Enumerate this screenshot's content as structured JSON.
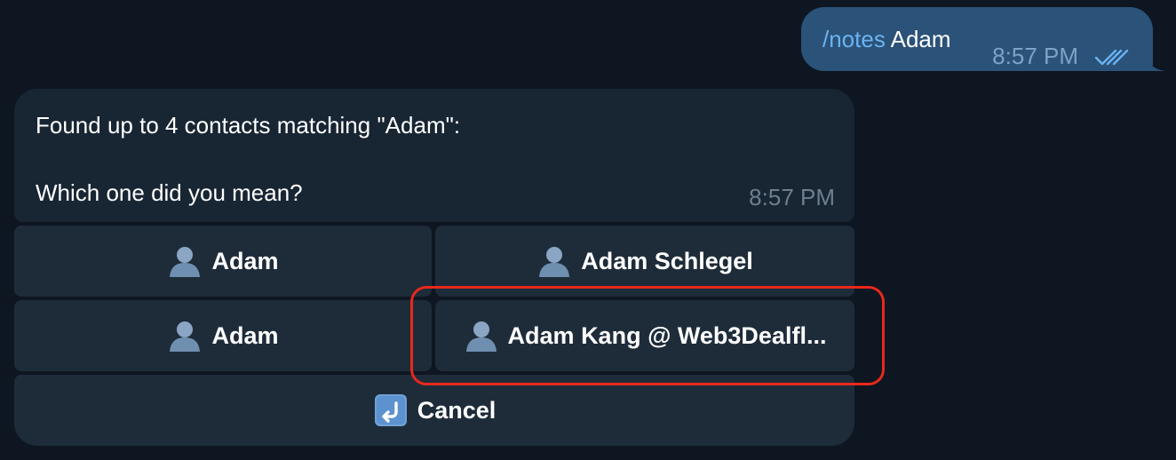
{
  "outgoing_message": {
    "command": "/notes",
    "text": " Adam",
    "time": "8:57 PM",
    "status_icon": "double-check-icon"
  },
  "incoming_message": {
    "line1": "Found up to 4 contacts matching \"Adam\":",
    "line2": "Which one did you mean?",
    "time": "8:57 PM"
  },
  "keyboard": {
    "buttons": [
      {
        "label": "Adam",
        "icon": "person-silhouette-icon"
      },
      {
        "label": "Adam Schlegel",
        "icon": "person-silhouette-icon"
      },
      {
        "label": "Adam",
        "icon": "person-silhouette-icon"
      },
      {
        "label": "Adam Kang @ Web3Dealfl...",
        "icon": "person-silhouette-icon"
      }
    ],
    "cancel": {
      "label": "Cancel",
      "icon": "return-arrow-icon"
    }
  },
  "colors": {
    "background": "#0e1621",
    "outgoing_bubble": "#2b5278",
    "incoming_bubble": "#182533",
    "button": "#1e2c3a",
    "command_link": "#6ab3f3",
    "highlight": "#e8281c"
  }
}
